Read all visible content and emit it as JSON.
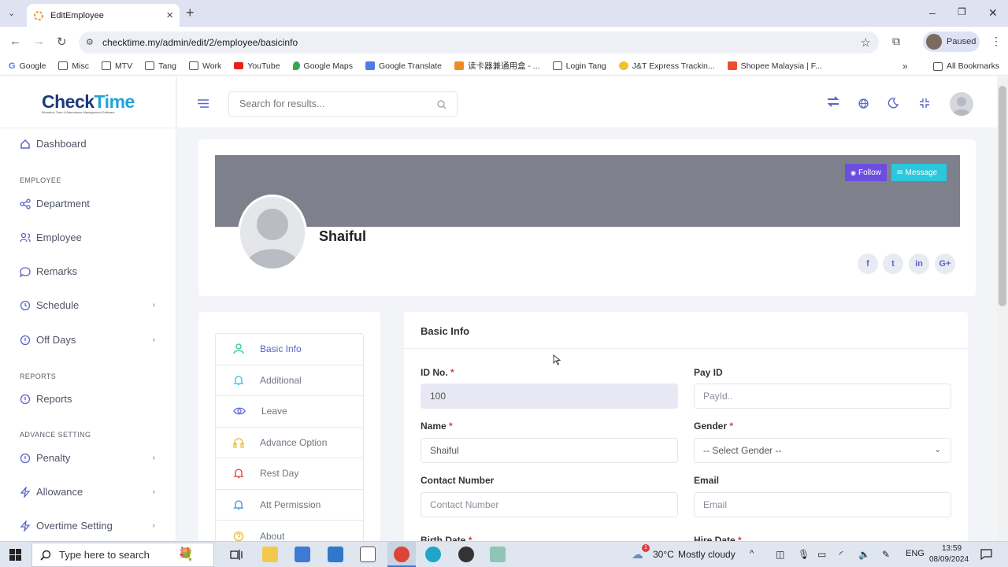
{
  "browser": {
    "tab_title": "EditEmployee",
    "url": "checktime.my/admin/edit/2/employee/basicinfo",
    "profile_status": "Paused",
    "bookmarks": [
      {
        "label": "Google",
        "icon": "google-icon"
      },
      {
        "label": "Misc",
        "icon": "folder-icon"
      },
      {
        "label": "MTV",
        "icon": "folder-icon"
      },
      {
        "label": "Tang",
        "icon": "folder-icon"
      },
      {
        "label": "Work",
        "icon": "folder-icon"
      },
      {
        "label": "YouTube",
        "icon": "youtube-icon"
      },
      {
        "label": "Google Maps",
        "icon": "maps-icon"
      },
      {
        "label": "Google Translate",
        "icon": "translate-icon"
      },
      {
        "label": "读卡器兼通用盒 - ...",
        "icon": "rss-icon"
      },
      {
        "label": "Login Tang",
        "icon": "folder-icon"
      },
      {
        "label": "J&T Express Trackin...",
        "icon": "jt-icon"
      },
      {
        "label": "Shopee Malaysia | F...",
        "icon": "shopee-icon"
      }
    ],
    "all_bookmarks": "All Bookmarks"
  },
  "app": {
    "logo_main": "Check",
    "logo_accent": "Time",
    "logo_sub": "Biometric Time & Attendance Management Software",
    "search_placeholder": "Search for results...",
    "sidebar": {
      "dashboard": "Dashboard",
      "section_employee": "EMPLOYEE",
      "department": "Department",
      "employee": "Employee",
      "remarks": "Remarks",
      "schedule": "Schedule",
      "off_days": "Off Days",
      "section_reports": "REPORTS",
      "reports": "Reports",
      "section_advance": "ADVANCE SETTING",
      "penalty": "Penalty",
      "allowance": "Allowance",
      "overtime": "Overtime Setting"
    },
    "profile": {
      "name": "Shaiful",
      "follow_label": "Follow",
      "message_label": "Message",
      "social": [
        "f",
        "t",
        "in",
        "G+"
      ]
    },
    "side_menu": [
      "Basic Info",
      "Additional",
      "Leave",
      "Advance Option",
      "Rest Day",
      "Att Permission",
      "About"
    ],
    "form": {
      "title": "Basic Info",
      "id_label": "ID No.",
      "id_value": "100",
      "payid_label": "Pay ID",
      "payid_placeholder": "PayId..",
      "name_label": "Name",
      "name_value": "Shaiful",
      "gender_label": "Gender",
      "gender_value": "-- Select Gender --",
      "contact_label": "Contact Number",
      "contact_placeholder": "Contact Number",
      "email_label": "Email",
      "email_placeholder": "Email",
      "birth_label": "Birth Date",
      "hire_label": "Hire Date",
      "required_mark": "*"
    },
    "colors": {
      "accent": "#5e63c8",
      "cover": "#7e818b",
      "follow": "#6c4de0",
      "message": "#2ac8dc"
    }
  },
  "taskbar": {
    "search_placeholder": "Type here to search",
    "weather_temp": "30°C",
    "weather_desc": "Mostly cloudy",
    "language": "ENG",
    "time": "13:59",
    "date": "08/09/2024",
    "weather_badge": "1"
  }
}
